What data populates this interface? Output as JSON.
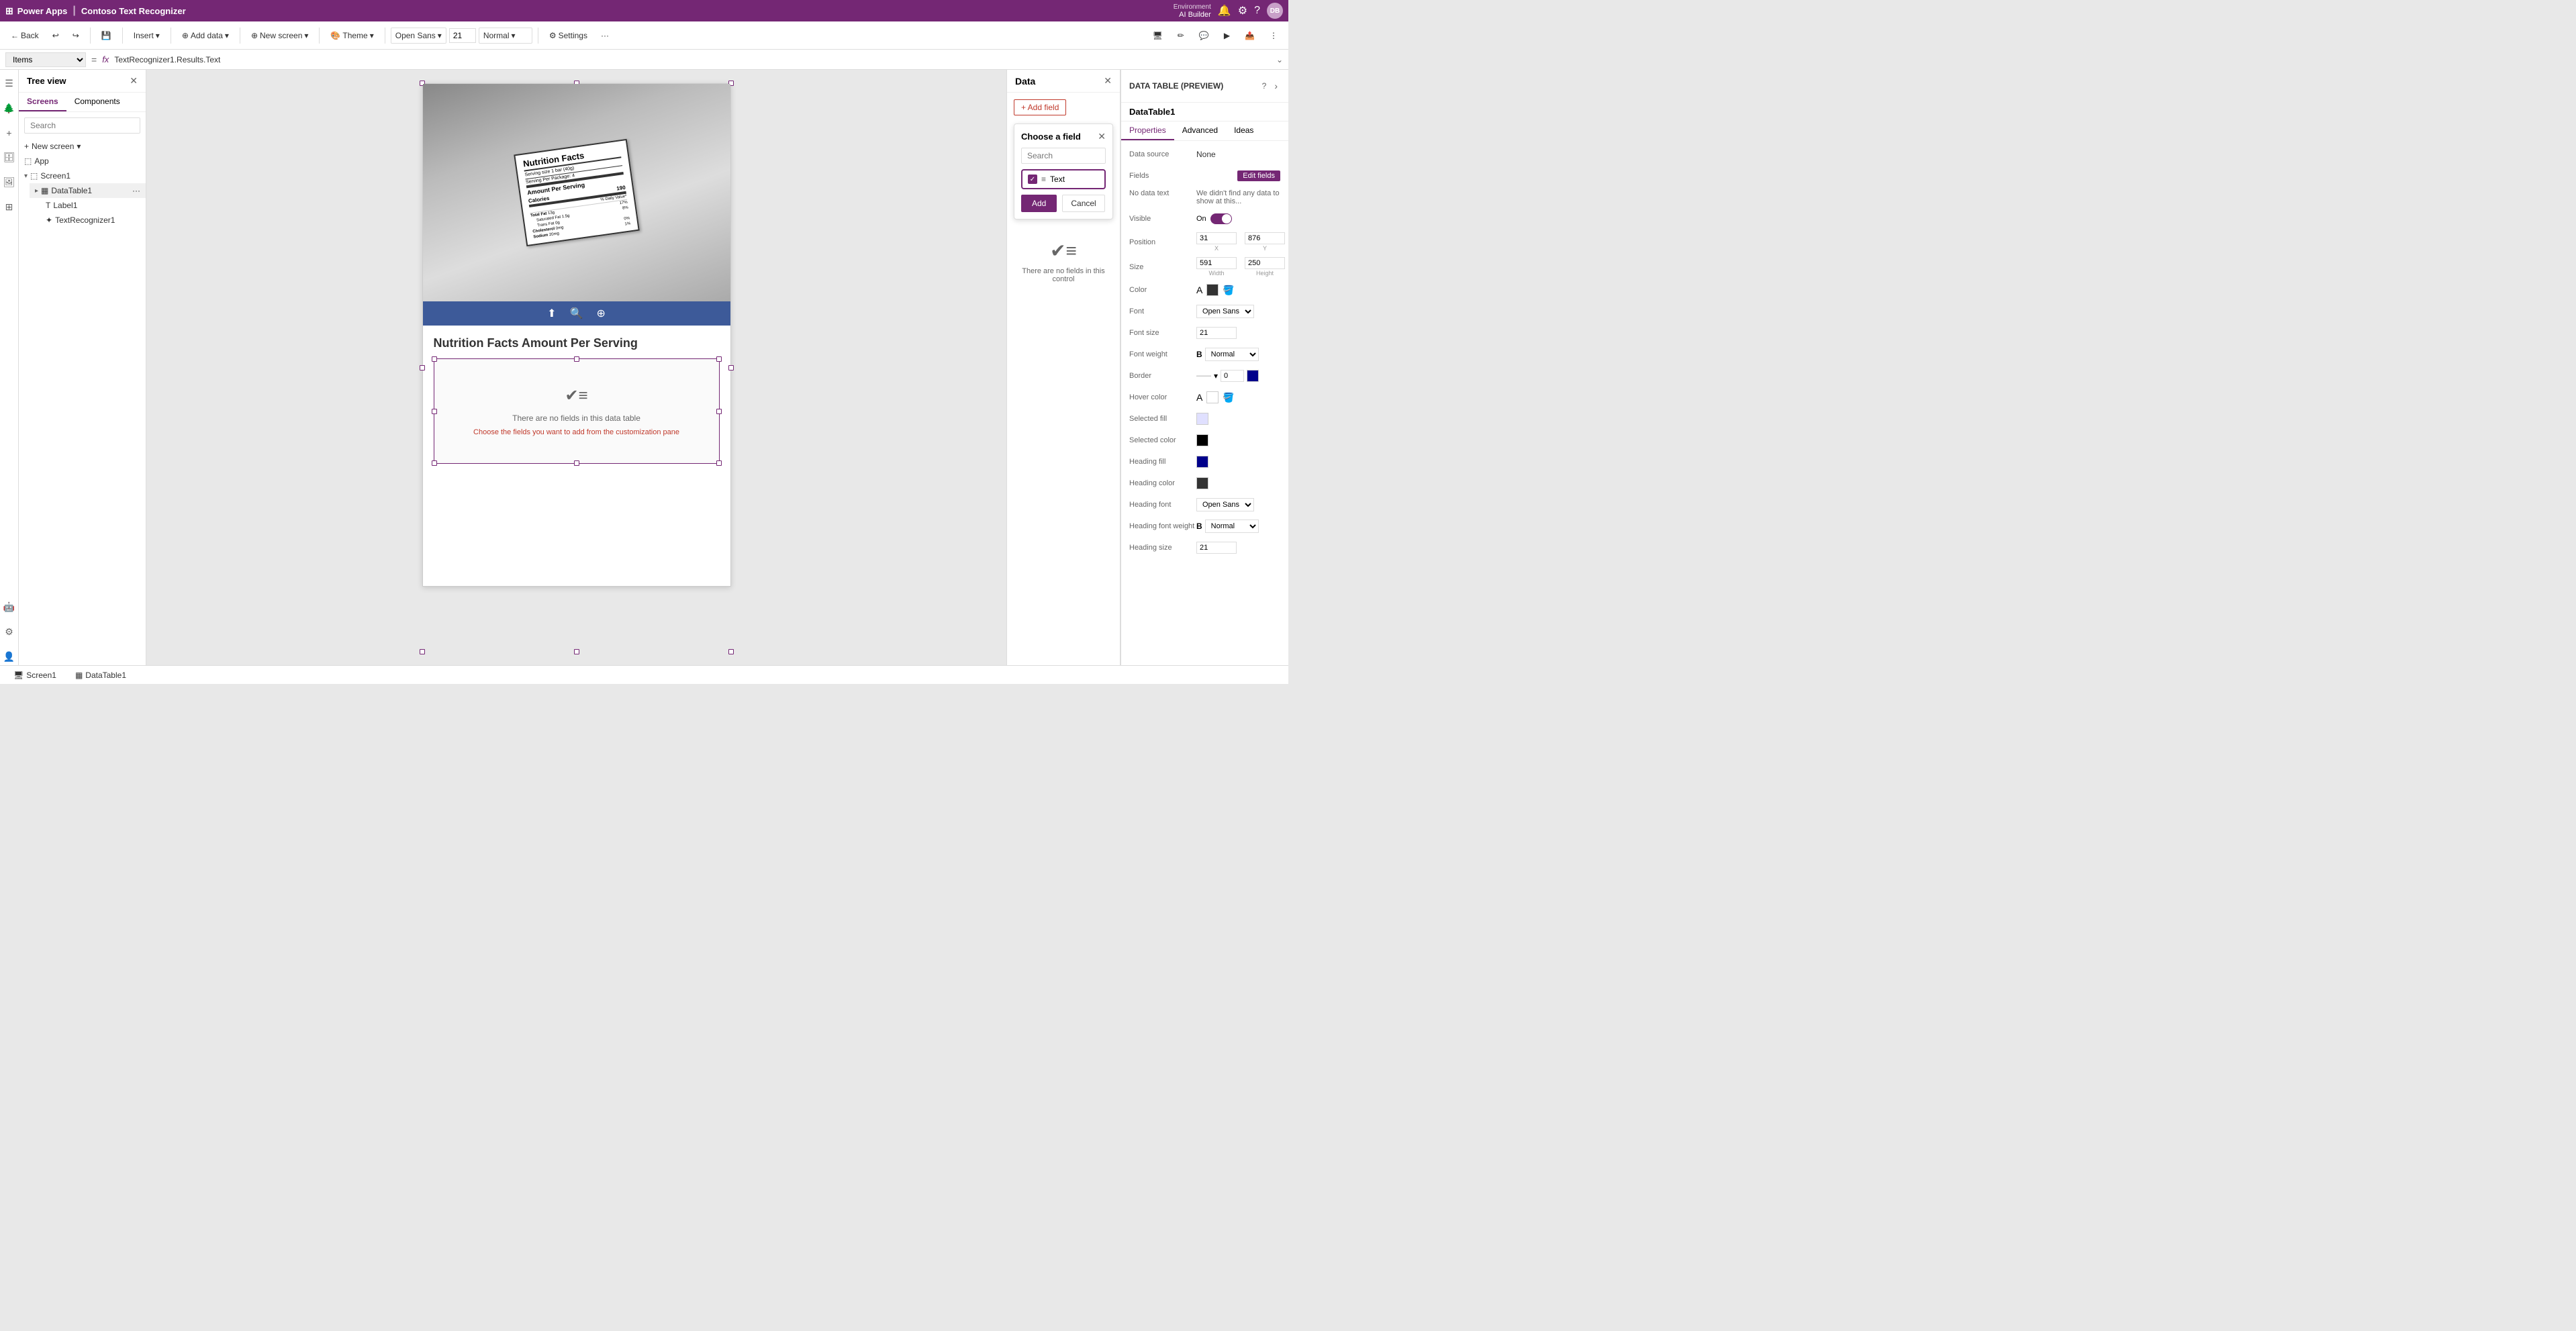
{
  "app": {
    "title": "Power Apps",
    "separator": "|",
    "app_name": "Contoso Text Recognizer"
  },
  "env": {
    "label": "Environment",
    "name": "AI Builder"
  },
  "toolbar": {
    "back": "Back",
    "insert": "Insert",
    "add_data": "Add data",
    "new_screen": "New screen",
    "theme": "Theme",
    "font": "Open Sans",
    "font_size": "21",
    "font_weight": "Normal",
    "settings": "Settings"
  },
  "formula_bar": {
    "items_label": "Items",
    "equals": "=",
    "fx": "fx",
    "formula": "TextRecognizer1.Results.Text"
  },
  "tree": {
    "title": "Tree view",
    "tabs": [
      "Screens",
      "Components"
    ],
    "active_tab": "Screens",
    "search_placeholder": "Search",
    "new_screen": "New screen",
    "items": [
      {
        "name": "App",
        "type": "app",
        "level": 0
      },
      {
        "name": "Screen1",
        "type": "screen",
        "level": 0,
        "expanded": true
      },
      {
        "name": "DataTable1",
        "type": "datatable",
        "level": 1
      },
      {
        "name": "Label1",
        "type": "label",
        "level": 2
      },
      {
        "name": "TextRecognizer1",
        "type": "textrecognizer",
        "level": 2
      }
    ]
  },
  "canvas": {
    "app_title": "Nutrition Facts Amount Per Serving",
    "data_table_empty_msg": "There are no fields in this data table",
    "data_table_hint": "Choose the fields you want to add from the customization pane"
  },
  "data_panel": {
    "title": "Data",
    "add_field_label": "+ Add field",
    "choose_field": {
      "title": "Choose a field",
      "search_placeholder": "Search",
      "fields": [
        {
          "name": "Text",
          "checked": true
        }
      ],
      "add_label": "Add",
      "cancel_label": "Cancel"
    },
    "no_fields_msg": "There are no fields in this control"
  },
  "properties": {
    "section_title": "DATA TABLE (PREVIEW)",
    "help_icon": "?",
    "name": "DataTable1",
    "tabs": [
      "Properties",
      "Advanced",
      "Ideas"
    ],
    "active_tab": "Properties",
    "rows": [
      {
        "label": "Data source",
        "value": "None"
      },
      {
        "label": "Fields",
        "value": "",
        "has_edit": true,
        "edit_label": "Edit fields"
      },
      {
        "label": "No data text",
        "value": "We didn't find any data to show at this..."
      },
      {
        "label": "Visible",
        "value": "On",
        "has_toggle": true
      },
      {
        "label": "Position",
        "x": "31",
        "y": "876"
      },
      {
        "label": "Size",
        "width": "591",
        "height": "250"
      },
      {
        "label": "Color",
        "has_color": true,
        "color": "#333333"
      },
      {
        "label": "Font",
        "value": "Open Sans",
        "has_dropdown": true
      },
      {
        "label": "Font size",
        "value": "21"
      },
      {
        "label": "Font weight",
        "value": "Normal",
        "prefix": "B",
        "has_dropdown": true
      },
      {
        "label": "Border",
        "value": "0",
        "has_color_border": true,
        "border_color": "#00008b"
      },
      {
        "label": "Hover color",
        "has_color": true,
        "color": "#ffffff"
      },
      {
        "label": "Selected fill",
        "has_color": true,
        "color": "#e0e0ff"
      },
      {
        "label": "Selected color",
        "has_color": true,
        "color": "#000000"
      },
      {
        "label": "Heading fill",
        "has_color": true,
        "color": "#0000cc"
      },
      {
        "label": "Heading color",
        "has_color": true,
        "color": "#333333"
      },
      {
        "label": "Heading font",
        "value": "Open Sans",
        "has_dropdown": true
      },
      {
        "label": "Heading font weight",
        "value": "Normal",
        "prefix": "B",
        "has_dropdown": true
      },
      {
        "label": "Heading size",
        "value": "21"
      }
    ]
  },
  "bottom_bar": {
    "tabs": [
      {
        "name": "Screen1",
        "icon": "🖥"
      },
      {
        "name": "DataTable1",
        "icon": "▦"
      }
    ]
  }
}
